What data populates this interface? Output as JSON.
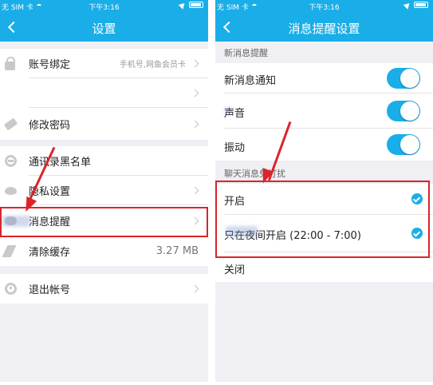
{
  "status": {
    "carrier": "无 SIM 卡",
    "time": "下午3:16"
  },
  "left": {
    "nav_title": "设置",
    "rows": [
      {
        "label": "账号绑定",
        "value": "手机号,网鱼会员卡",
        "icon": "lock-icon"
      },
      {
        "label": "",
        "value": "",
        "icon": ""
      },
      {
        "label": "修改密码",
        "value": "",
        "icon": "tag-icon"
      },
      {
        "label": "通讯录黑名单",
        "value": "",
        "icon": "ban-icon"
      },
      {
        "label": "隐私设置",
        "value": "",
        "icon": "eye-icon"
      },
      {
        "label": "消息提醒",
        "value": "",
        "icon": "speech-bubble-icon"
      },
      {
        "label": "清除缓存",
        "value": "3.27 MB",
        "icon": "broom-icon"
      },
      {
        "label": "退出帐号",
        "value": "",
        "icon": "power-icon"
      }
    ]
  },
  "right": {
    "nav_title": "消息提醒设置",
    "section_new": "新消息提醒",
    "toggles": [
      {
        "label": "新消息通知",
        "on": true
      },
      {
        "label": "声音",
        "on": true
      },
      {
        "label": "振动",
        "on": true
      }
    ],
    "section_dnd": "聊天消息免打扰",
    "options": [
      {
        "label": "开启",
        "checked": true
      },
      {
        "label": "只在夜间开启 (22:00 - 7:00)",
        "checked": true
      },
      {
        "label": "关闭",
        "checked": false
      }
    ]
  },
  "colors": {
    "accent": "#1aaee8",
    "annotation": "#d9252b",
    "background": "#efeff4"
  }
}
